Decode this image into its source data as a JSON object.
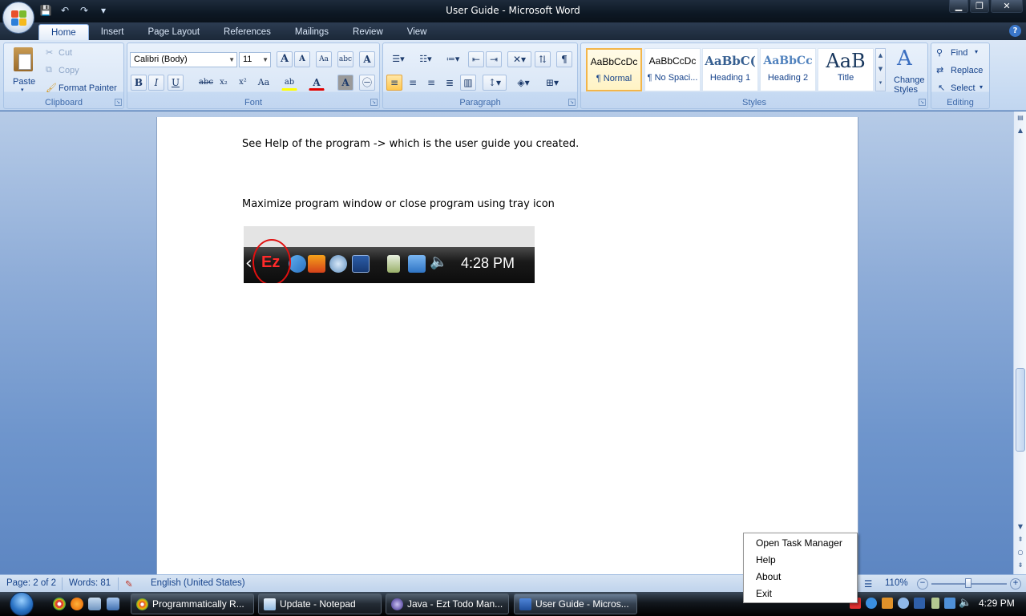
{
  "window": {
    "title": "User Guide - Microsoft Word"
  },
  "qat": {
    "save": "💾",
    "undo": "↶",
    "redo": "↷",
    "customize": "▾"
  },
  "win_controls": {
    "minimize": "▁",
    "restore": "❐",
    "close": "✕"
  },
  "help": "?",
  "tabs": [
    "Home",
    "Insert",
    "Page Layout",
    "References",
    "Mailings",
    "Review",
    "View"
  ],
  "ribbon": {
    "clipboard": {
      "label": "Clipboard",
      "paste": "Paste",
      "cut": "Cut",
      "copy": "Copy",
      "format_painter": "Format Painter"
    },
    "font": {
      "label": "Font",
      "font_name": "Calibri (Body)",
      "font_size": "11",
      "grow": "A",
      "shrink": "A",
      "clear": "Aa",
      "bold": "B",
      "italic": "I",
      "underline": "U",
      "strike": "abc",
      "subscript": "x₂",
      "superscript": "x²",
      "change_case": "Aa",
      "highlight": "ab",
      "font_color": "A",
      "shading": "A"
    },
    "paragraph": {
      "label": "Paragraph",
      "pilcrow": "¶"
    },
    "styles": {
      "label": "Styles",
      "change_styles_line1": "Change",
      "change_styles_line2": "Styles",
      "items": [
        {
          "sample": "AaBbCcDc",
          "name": "¶ Normal"
        },
        {
          "sample": "AaBbCcDc",
          "name": "¶ No Spaci..."
        },
        {
          "sample": "AaBbC(",
          "name": "Heading 1"
        },
        {
          "sample": "AaBbCc",
          "name": "Heading 2"
        },
        {
          "sample": "AaB",
          "name": "Title"
        }
      ]
    },
    "editing": {
      "label": "Editing",
      "find": "Find",
      "replace": "Replace",
      "select": "Select"
    }
  },
  "document": {
    "line1": "See Help of the program -> which is the user guide you created.",
    "line2": "Maximize program window or close program using tray icon",
    "tray_image": {
      "ez_label": "Ez",
      "clock": "4:28 PM",
      "arrow": "‹"
    }
  },
  "context_menu": [
    "Open Task Manager",
    "Help",
    "About",
    "Exit"
  ],
  "statusbar": {
    "page": "Page: 2 of 2",
    "words": "Words: 81",
    "language": "English (United States)",
    "zoom": "110%",
    "zoom_out": "−",
    "zoom_in": "+"
  },
  "taskbar": {
    "tasks": [
      {
        "label": "Programmatically R...",
        "color": "#e8a020"
      },
      {
        "label": "Update - Notepad",
        "color": "#8fb8e0"
      },
      {
        "label": "Java - Ezt Todo Man...",
        "color": "#6a5acd"
      },
      {
        "label": "User Guide - Micros...",
        "color": "#2b5fb4"
      }
    ],
    "clock": "4:29 PM"
  },
  "colors": {
    "accent": "#15428b",
    "ez_red": "#e01010",
    "selected_style": "#f2b54a"
  }
}
